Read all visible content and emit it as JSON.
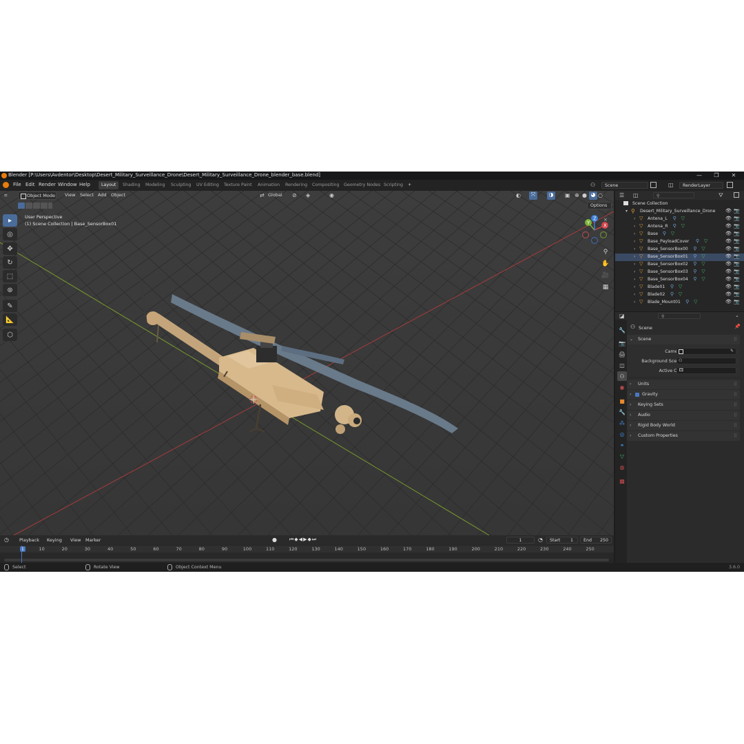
{
  "titlebar": {
    "title": "Blender [P:\\Users\\Avdentor\\Desktop\\Desert_Military_Surveillance_Drone\\Desert_Military_Surveillance_Drone_blender_base.blend]",
    "minimize": "—",
    "maximize": "❐",
    "close": "✕"
  },
  "menus": [
    "File",
    "Edit",
    "Render",
    "Window",
    "Help"
  ],
  "workspaces": [
    "Layout",
    "Shading",
    "Modeling",
    "Sculpting",
    "UV Editing",
    "Texture Paint",
    "Animation",
    "Rendering",
    "Compositing",
    "Geometry Nodes",
    "Scripting"
  ],
  "add_workspace": "+",
  "scene_field": "Scene",
  "view_layer_field": "RenderLayer",
  "viewport": {
    "mode": "Object Mode",
    "menus": [
      "View",
      "Select",
      "Add",
      "Object"
    ],
    "transform_orientation": "Global",
    "options": "Options",
    "perspective_label": "User Perspective",
    "context_label": "(1) Scene Collection | Base_SensorBox01"
  },
  "gizmo": {
    "x": "X",
    "y": "Y",
    "z": "Z"
  },
  "timeline": {
    "menus": [
      "Playback",
      "Keying",
      "View",
      "Marker"
    ],
    "current_frame": "1",
    "start_label": "Start",
    "start": "1",
    "end_label": "End",
    "end": "250",
    "ticks": [
      "1",
      "10",
      "20",
      "30",
      "40",
      "50",
      "60",
      "70",
      "80",
      "90",
      "100",
      "110",
      "120",
      "130",
      "140",
      "150",
      "160",
      "170",
      "180",
      "190",
      "200",
      "210",
      "220",
      "230",
      "240",
      "250"
    ]
  },
  "statusbar": {
    "select": "Select",
    "rotate": "Rotate View",
    "context_menu": "Object Context Menu",
    "version": "3.6.0"
  },
  "outliner": {
    "root": "Scene Collection",
    "collection": "Desert_Military_Surveillance_Drone",
    "items": [
      "Antena_L",
      "Antena_R",
      "Base",
      "Base_PayloadCover",
      "Base_SensorBox00",
      "Base_SensorBox01",
      "Base_SensorBox02",
      "Base_SensorBox03",
      "Base_SensorBox04",
      "Blade01",
      "Blade02",
      "Blade_Mount01"
    ]
  },
  "properties": {
    "breadcrumb": "Scene",
    "section": "Scene",
    "camera_label": "Camera",
    "background_label": "Background Scene",
    "active_clip_label": "Active Clip",
    "panels": [
      "Units",
      "Gravity",
      "Keying Sets",
      "Audio",
      "Rigid Body World",
      "Custom Properties"
    ]
  },
  "colors": {
    "accent": "#4a6c9a",
    "x_axis": "#a83b3b",
    "y_axis": "#7a9a2e",
    "gizmo_x": "#d0454b",
    "gizmo_y": "#7bb43a",
    "gizmo_z": "#3e7fd6"
  }
}
